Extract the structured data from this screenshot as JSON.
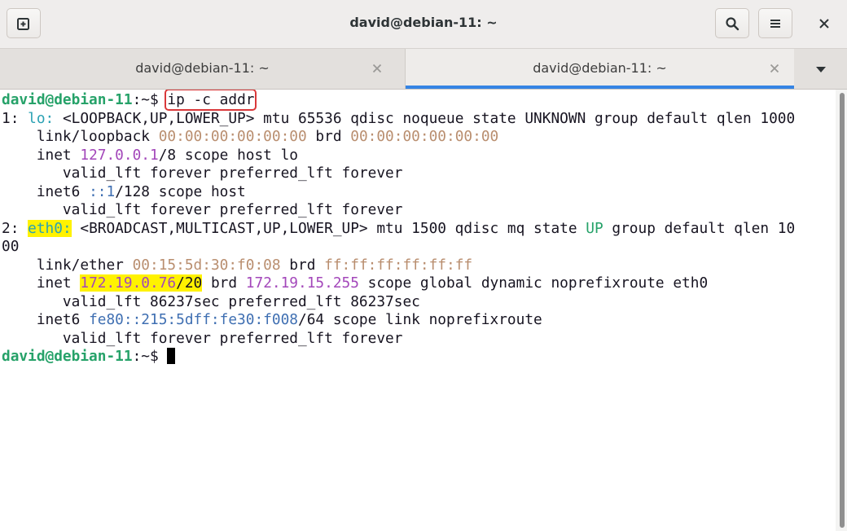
{
  "window": {
    "title": "david@debian-11: ~",
    "new_tab_icon": "new-tab-icon",
    "search_icon": "search-icon",
    "menu_icon": "hamburger-menu-icon",
    "close_icon": "close-icon"
  },
  "tabs": [
    {
      "label": "david@debian-11: ~",
      "active": false
    },
    {
      "label": "david@debian-11: ~",
      "active": true
    }
  ],
  "colors": {
    "prompt": "#26a269",
    "accent": "#3584e4",
    "highlight": "#fff200",
    "command_box": "#d9383a"
  },
  "terminal": {
    "prompt": "david@debian-11",
    "prompt_suffix": ":~$ ",
    "command": "ip -c addr",
    "lines": {
      "l1_num": "1: ",
      "l1_if": "lo:",
      "l1_rest": " <LOOPBACK,UP,LOWER_UP> mtu 65536 qdisc noqueue state UNKNOWN group default qlen 1000",
      "l2_a": "    link/loopback ",
      "l2_mac": "00:00:00:00:00:00",
      "l2_b": " brd ",
      "l2_brd": "00:00:00:00:00:00",
      "l3_a": "    inet ",
      "l3_ip": "127.0.0.1",
      "l3_b": "/8 scope host lo",
      "l4": "       valid_lft forever preferred_lft forever",
      "l5_a": "    inet6 ",
      "l5_ip": "::1",
      "l5_b": "/128 scope host",
      "l6": "       valid_lft forever preferred_lft forever",
      "l7_num": "2: ",
      "l7_if": "eth0:",
      "l7_rest": " <BROADCAST,MULTICAST,UP,LOWER_UP> mtu 1500 qdisc mq state ",
      "l7_state": "UP",
      "l7_tail": " group default qlen 10",
      "l8": "00",
      "l9_a": "    link/ether ",
      "l9_mac": "00:15:5d:30:f0:08",
      "l9_b": " brd ",
      "l9_brd": "ff:ff:ff:ff:ff:ff",
      "l10_a": "    inet ",
      "l10_ip": "172.19.0.76",
      "l10_mask": "/20",
      "l10_b": " brd ",
      "l10_brd": "172.19.15.255",
      "l10_c": " scope global dynamic noprefixroute eth0",
      "l11": "       valid_lft 86237sec preferred_lft 86237sec",
      "l12_a": "    inet6 ",
      "l12_ip": "fe80::215:5dff:fe30:f008",
      "l12_b": "/64 scope link noprefixroute",
      "l13": "       valid_lft forever preferred_lft forever"
    }
  }
}
